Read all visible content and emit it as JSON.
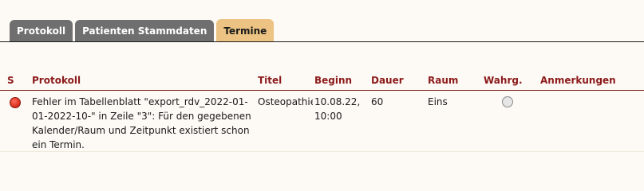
{
  "tabs": [
    {
      "label": "Protokoll"
    },
    {
      "label": "Patienten Stammdaten"
    },
    {
      "label": "Termine"
    }
  ],
  "table": {
    "columns": [
      "S",
      "Protokoll",
      "Titel",
      "Beginn",
      "Dauer",
      "Raum",
      "Wahrg.",
      "Anmerkungen"
    ],
    "rows": [
      {
        "status": "error",
        "protokoll": "Fehler im Tabellenblatt \"export_rdv_2022-01-01-2022-10-\" in Zeile \"3\": Für den gegebenen Kalender/Raum und Zeitpunkt existiert schon ein Termin.",
        "titel": "Osteopathie",
        "beginn": "10.08.22, 10:00",
        "dauer": "60",
        "raum": "Eins",
        "anmerkungen": ""
      }
    ]
  },
  "colors": {
    "tab_active": "#ecc382",
    "tab_inactive": "#6f6f6f",
    "header_text": "#8b1a1a",
    "status_error": "#e53b2a"
  }
}
